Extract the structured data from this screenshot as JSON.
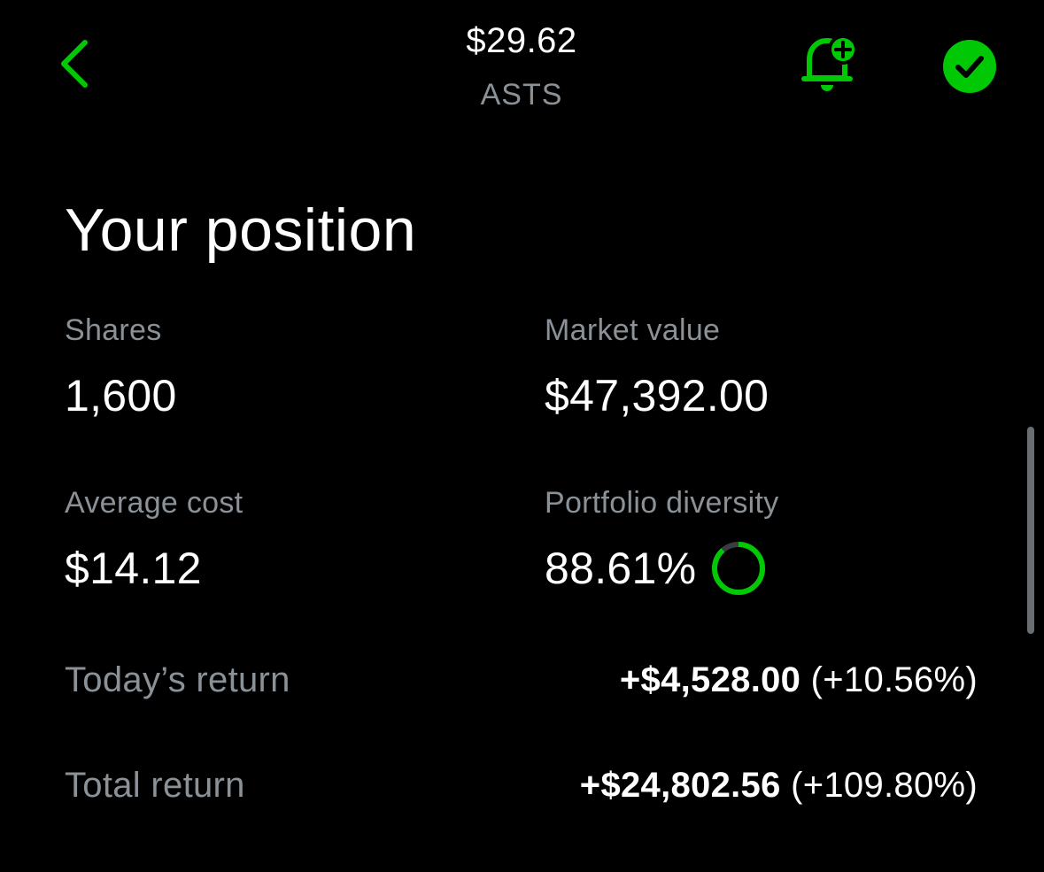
{
  "header": {
    "price": "$29.62",
    "ticker": "ASTS"
  },
  "section": {
    "title": "Your position"
  },
  "stats": {
    "shares": {
      "label": "Shares",
      "value": "1,600"
    },
    "market_value": {
      "label": "Market value",
      "value": "$47,392.00"
    },
    "average_cost": {
      "label": "Average cost",
      "value": "$14.12"
    },
    "portfolio_diversity": {
      "label": "Portfolio diversity",
      "value": "88.61%",
      "fraction": 0.8861
    }
  },
  "returns": {
    "today": {
      "label": "Today’s return",
      "amount": "+$4,528.00",
      "percent": "(+10.56%)"
    },
    "total": {
      "label": "Total return",
      "amount": "+$24,802.56",
      "percent": "(+109.80%)"
    }
  },
  "colors": {
    "accent": "#00c805",
    "background": "#000000",
    "muted": "#8a9197",
    "ring_track": "#3a3d40"
  },
  "icons": {
    "back": "chevron-left-icon",
    "alert": "bell-plus-icon",
    "check": "check-circle-icon"
  }
}
